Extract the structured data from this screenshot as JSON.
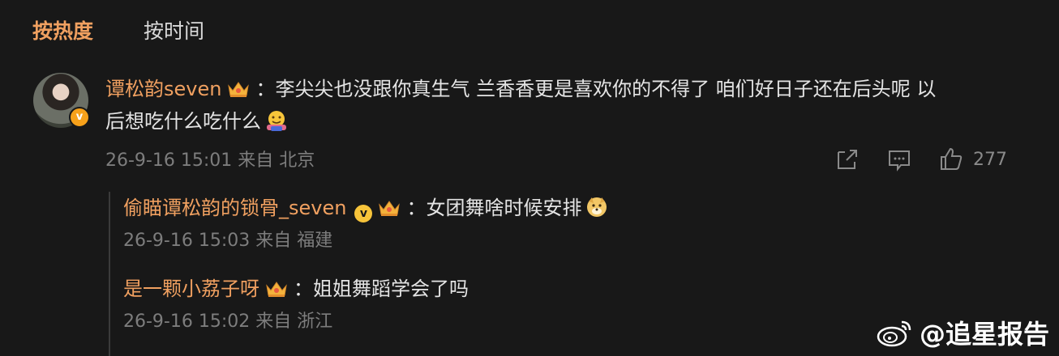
{
  "tabs": {
    "hot": "按热度",
    "time": "按时间"
  },
  "comment": {
    "username": "谭松韵seven",
    "sep": "：",
    "text_line1": "李尖尖也没跟你真生气 兰香香更是喜欢你的不得了 咱们好日子还在后头呢 以",
    "text_line2": "后想吃什么吃什么",
    "meta": "26-9-16 15:01 来自 北京",
    "likes": "277",
    "avatar_badge": "v"
  },
  "replies": [
    {
      "username": "偷瞄谭松韵的锁骨_seven",
      "sep": "：",
      "text": "女团舞啥时候安排",
      "meta": "26-9-16 15:03 来自 福建",
      "vmark": "v"
    },
    {
      "username": "是一颗小荔子呀",
      "sep": "：",
      "text": "姐姐舞蹈学会了吗",
      "meta": "26-9-16 15:02 来自 浙江"
    }
  ],
  "watermark": "@追星报告",
  "colors": {
    "accent": "#f0a060",
    "background": "#181818",
    "meta": "#7d7d7d"
  },
  "icons": [
    "crown-icon",
    "share-icon",
    "comment-icon",
    "like-icon",
    "weibo-logo-icon",
    "emoji-hug-icon",
    "emoji-doge-icon"
  ]
}
